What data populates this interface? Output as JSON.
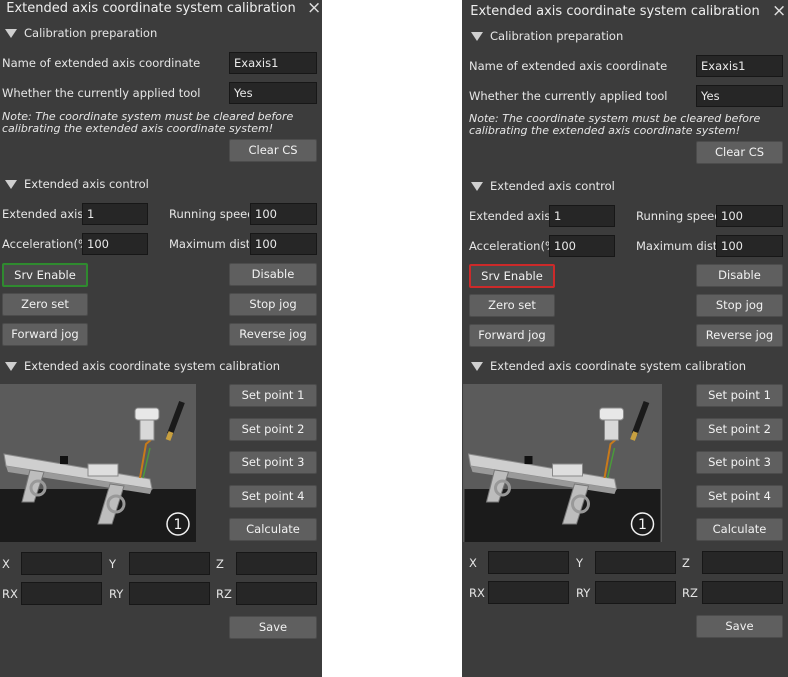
{
  "dialog": {
    "title": "Extended axis coordinate system calibration",
    "close_icon": "×"
  },
  "prep": {
    "header": "Calibration preparation",
    "name_label": "Name of extended axis coordinate system",
    "name_value": "Exaxis1",
    "tool_label": "Whether the currently applied tool coordinate system",
    "tool_value": "Yes",
    "note": "Note: The coordinate system must be cleared before calibrating the extended axis coordinate system!",
    "clear_button": "Clear CS"
  },
  "control": {
    "header": "Extended axis control",
    "axis_num_label": "Extended axis number",
    "axis_num_value": "1",
    "speed_label": "Running speed(%)",
    "speed_value": "100",
    "accel_label": "Acceleration(%)",
    "accel_value": "100",
    "maxdist_label": "Maximum distance",
    "maxdist_value": "100",
    "srv_enable": "Srv Enable",
    "disable": "Disable",
    "zero_set": "Zero set",
    "stop_jog": "Stop jog",
    "forward_jog": "Forward jog",
    "reverse_jog": "Reverse jog"
  },
  "calibration": {
    "header": "Extended axis coordinate system calibration",
    "image_badge": "1",
    "set_point_1": "Set point 1",
    "set_point_2": "Set point 2",
    "set_point_3": "Set point 3",
    "set_point_4": "Set point 4",
    "calculate": "Calculate",
    "x": "X",
    "y": "Y",
    "z": "Z",
    "rx": "RX",
    "ry": "RY",
    "rz": "RZ",
    "save": "Save"
  },
  "states": {
    "left_srv_enable_border": "#2f8a2f",
    "right_srv_enable_border": "#cc2a2a",
    "panel_background": "#3c3c3c"
  }
}
